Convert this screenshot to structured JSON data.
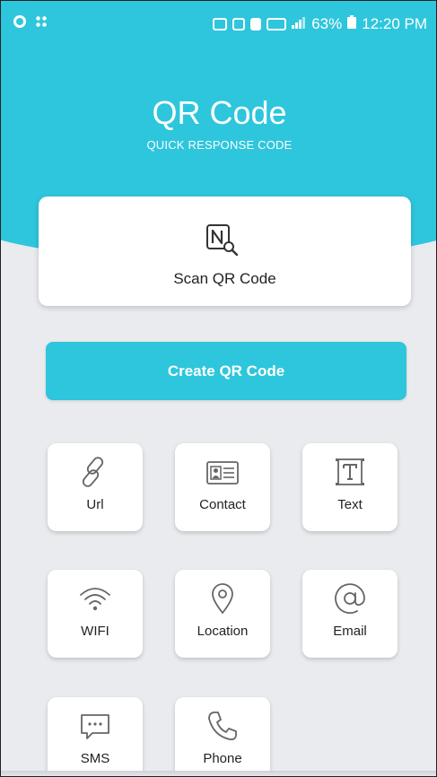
{
  "status_bar": {
    "left_icons": [
      "settings-icon",
      "grid-icon"
    ],
    "right_indicators": [
      "nfc-icon",
      "volte-icon",
      "sim-icon",
      "lte-icon",
      "signal-icon"
    ],
    "battery": "63%",
    "time": "12:20 PM"
  },
  "header": {
    "title": "QR Code",
    "subtitle": "QUICK RESPONSE CODE"
  },
  "scan": {
    "label": "Scan QR Code",
    "icon": "nfc-scan-icon"
  },
  "create": {
    "label": "Create QR Code"
  },
  "tiles": [
    {
      "label": "Url",
      "icon": "link-icon"
    },
    {
      "label": "Contact",
      "icon": "contact-card-icon"
    },
    {
      "label": "Text",
      "icon": "text-icon"
    },
    {
      "label": "WIFI",
      "icon": "wifi-icon"
    },
    {
      "label": "Location",
      "icon": "location-pin-icon"
    },
    {
      "label": "Email",
      "icon": "at-icon"
    },
    {
      "label": "SMS",
      "icon": "sms-icon"
    },
    {
      "label": "Phone",
      "icon": "phone-icon"
    }
  ],
  "colors": {
    "accent": "#2ec6dc",
    "background": "#e9ebee",
    "card": "#ffffff"
  }
}
